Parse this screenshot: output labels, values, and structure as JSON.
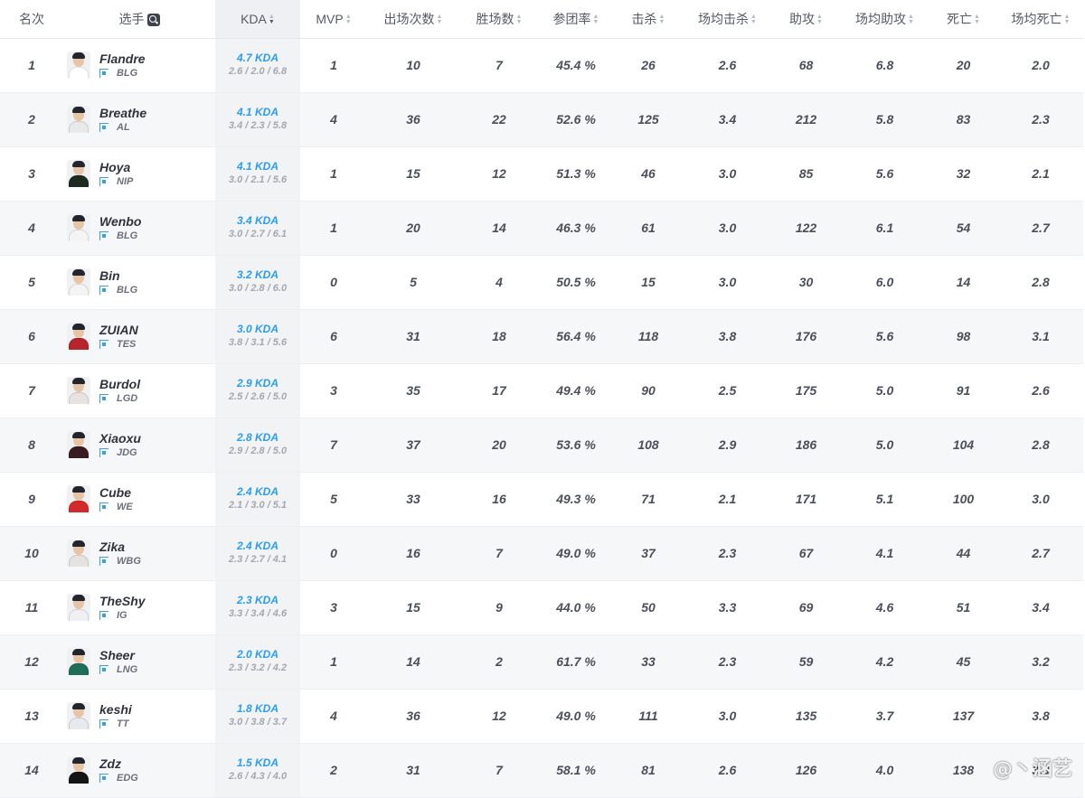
{
  "headers": {
    "rank": "名次",
    "player": "选手",
    "kda": "KDA",
    "mvp": "MVP",
    "games": "出场次数",
    "wins": "胜场数",
    "kp": "参团率",
    "kills": "击杀",
    "avg_kills": "场均击杀",
    "assists": "助攻",
    "avg_assists": "场均助攻",
    "deaths": "死亡",
    "avg_deaths": "场均死亡"
  },
  "rows": [
    {
      "rank": "1",
      "name": "Flandre",
      "team": "BLG",
      "kda": "4.7 KDA",
      "kda_detail": "2.6 / 2.0 / 6.8",
      "mvp": "1",
      "games": "10",
      "wins": "7",
      "kp": "45.4 %",
      "kills": "26",
      "avg_kills": "2.6",
      "assists": "68",
      "avg_assists": "6.8",
      "deaths": "20",
      "avg_deaths": "2.0",
      "jersey": "#ffffff"
    },
    {
      "rank": "2",
      "name": "Breathe",
      "team": "AL",
      "kda": "4.1 KDA",
      "kda_detail": "3.4 / 2.3 / 5.8",
      "mvp": "4",
      "games": "36",
      "wins": "22",
      "kp": "52.6 %",
      "kills": "125",
      "avg_kills": "3.4",
      "assists": "212",
      "avg_assists": "5.8",
      "deaths": "83",
      "avg_deaths": "2.3",
      "jersey": "#e9e9ea"
    },
    {
      "rank": "3",
      "name": "Hoya",
      "team": "NIP",
      "kda": "4.1 KDA",
      "kda_detail": "3.0 / 2.1 / 5.6",
      "mvp": "1",
      "games": "15",
      "wins": "12",
      "kp": "51.3 %",
      "kills": "46",
      "avg_kills": "3.0",
      "assists": "85",
      "avg_assists": "5.6",
      "deaths": "32",
      "avg_deaths": "2.1",
      "jersey": "#1d2a1f"
    },
    {
      "rank": "4",
      "name": "Wenbo",
      "team": "BLG",
      "kda": "3.4 KDA",
      "kda_detail": "3.0 / 2.7 / 6.1",
      "mvp": "1",
      "games": "20",
      "wins": "14",
      "kp": "46.3 %",
      "kills": "61",
      "avg_kills": "3.0",
      "assists": "122",
      "avg_assists": "6.1",
      "deaths": "54",
      "avg_deaths": "2.7",
      "jersey": "#f4f4f5"
    },
    {
      "rank": "5",
      "name": "Bin",
      "team": "BLG",
      "kda": "3.2 KDA",
      "kda_detail": "3.0 / 2.8 / 6.0",
      "mvp": "0",
      "games": "5",
      "wins": "4",
      "kp": "50.5 %",
      "kills": "15",
      "avg_kills": "3.0",
      "assists": "30",
      "avg_assists": "6.0",
      "deaths": "14",
      "avg_deaths": "2.8",
      "jersey": "#f4f4f5"
    },
    {
      "rank": "6",
      "name": "ZUIAN",
      "team": "TES",
      "kda": "3.0 KDA",
      "kda_detail": "3.8 / 3.1 / 5.6",
      "mvp": "6",
      "games": "31",
      "wins": "18",
      "kp": "56.4 %",
      "kills": "118",
      "avg_kills": "3.8",
      "assists": "176",
      "avg_assists": "5.6",
      "deaths": "98",
      "avg_deaths": "3.1",
      "jersey": "#b7242b"
    },
    {
      "rank": "7",
      "name": "Burdol",
      "team": "LGD",
      "kda": "2.9 KDA",
      "kda_detail": "2.5 / 2.6 / 5.0",
      "mvp": "3",
      "games": "35",
      "wins": "17",
      "kp": "49.4 %",
      "kills": "90",
      "avg_kills": "2.5",
      "assists": "175",
      "avg_assists": "5.0",
      "deaths": "91",
      "avg_deaths": "2.6",
      "jersey": "#e8e3e1"
    },
    {
      "rank": "8",
      "name": "Xiaoxu",
      "team": "JDG",
      "kda": "2.8 KDA",
      "kda_detail": "2.9 / 2.8 / 5.0",
      "mvp": "7",
      "games": "37",
      "wins": "20",
      "kp": "53.6 %",
      "kills": "108",
      "avg_kills": "2.9",
      "assists": "186",
      "avg_assists": "5.0",
      "deaths": "104",
      "avg_deaths": "2.8",
      "jersey": "#3a1b1f"
    },
    {
      "rank": "9",
      "name": "Cube",
      "team": "WE",
      "kda": "2.4 KDA",
      "kda_detail": "2.1 / 3.0 / 5.1",
      "mvp": "5",
      "games": "33",
      "wins": "16",
      "kp": "49.3 %",
      "kills": "71",
      "avg_kills": "2.1",
      "assists": "171",
      "avg_assists": "5.1",
      "deaths": "100",
      "avg_deaths": "3.0",
      "jersey": "#d22a2a"
    },
    {
      "rank": "10",
      "name": "Zika",
      "team": "WBG",
      "kda": "2.4 KDA",
      "kda_detail": "2.3 / 2.7 / 4.1",
      "mvp": "0",
      "games": "16",
      "wins": "7",
      "kp": "49.0 %",
      "kills": "37",
      "avg_kills": "2.3",
      "assists": "67",
      "avg_assists": "4.1",
      "deaths": "44",
      "avg_deaths": "2.7",
      "jersey": "#e6e2e0"
    },
    {
      "rank": "11",
      "name": "TheShy",
      "team": "IG",
      "kda": "2.3 KDA",
      "kda_detail": "3.3 / 3.4 / 4.6",
      "mvp": "3",
      "games": "15",
      "wins": "9",
      "kp": "44.0 %",
      "kills": "50",
      "avg_kills": "3.3",
      "assists": "69",
      "avg_assists": "4.6",
      "deaths": "51",
      "avg_deaths": "3.4",
      "jersey": "#eef0f4"
    },
    {
      "rank": "12",
      "name": "Sheer",
      "team": "LNG",
      "kda": "2.0 KDA",
      "kda_detail": "2.3 / 3.2 / 4.2",
      "mvp": "1",
      "games": "14",
      "wins": "2",
      "kp": "61.7 %",
      "kills": "33",
      "avg_kills": "2.3",
      "assists": "59",
      "avg_assists": "4.2",
      "deaths": "45",
      "avg_deaths": "3.2",
      "jersey": "#1f6e5a"
    },
    {
      "rank": "13",
      "name": "keshi",
      "team": "TT",
      "kda": "1.8 KDA",
      "kda_detail": "3.0 / 3.8 / 3.7",
      "mvp": "4",
      "games": "36",
      "wins": "12",
      "kp": "49.0 %",
      "kills": "111",
      "avg_kills": "3.0",
      "assists": "135",
      "avg_assists": "3.7",
      "deaths": "137",
      "avg_deaths": "3.8",
      "jersey": "#e7e9ec"
    },
    {
      "rank": "14",
      "name": "Zdz",
      "team": "EDG",
      "kda": "1.5 KDA",
      "kda_detail": "2.6 / 4.3 / 4.0",
      "mvp": "2",
      "games": "31",
      "wins": "7",
      "kp": "58.1 %",
      "kills": "81",
      "avg_kills": "2.6",
      "assists": "126",
      "avg_assists": "4.0",
      "deaths": "138",
      "avg_deaths": "3.3",
      "jersey": "#141414"
    }
  ],
  "watermark": "@丶涵艺",
  "colors": {
    "accent": "#2a9df4",
    "team_icon": "#3aa0e0"
  }
}
